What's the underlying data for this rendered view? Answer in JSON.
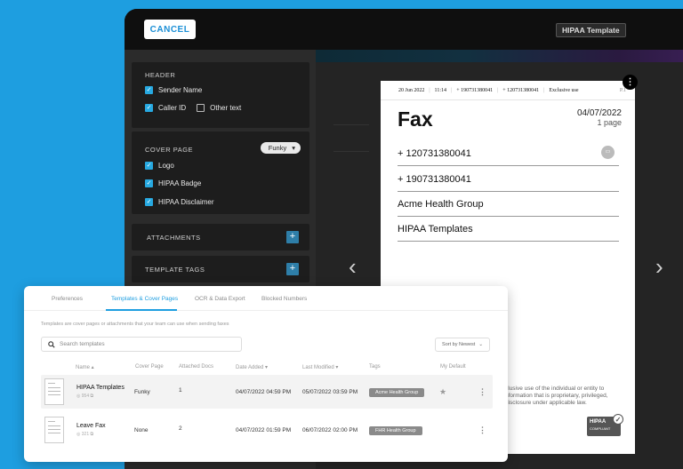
{
  "editor": {
    "cancel_label": "CANCEL",
    "title": "HIPAA Template",
    "sections": {
      "header": {
        "title": "HEADER",
        "sender_name": "Sender Name",
        "caller_id": "Caller ID",
        "other_text": "Other text"
      },
      "cover_page": {
        "title": "COVER PAGE",
        "dropdown_value": "Funky",
        "logo": "Logo",
        "hipaa_badge": "HIPAA Badge",
        "hipaa_disclaimer": "HIPAA Disclaimer"
      },
      "attachments": {
        "title": "ATTACHMENTS"
      },
      "template_tags": {
        "title": "TEMPLATE TAGS"
      }
    }
  },
  "fax": {
    "header": {
      "date": "20 Jun 2022",
      "time": "11:14",
      "from": "+ 190731380041",
      "to": "+ 120731380041",
      "label": "Exclusive use",
      "page": "P.1"
    },
    "title": "Fax",
    "date": "04/07/2022",
    "pages": "1 page",
    "fields": [
      "+ 120731380041",
      "+ 190731380041",
      "Acme Health Group",
      "HIPAA Templates"
    ],
    "disclaimer": "clusive use of the individual or entity to nformation that is proprietary, privileged, disclosure under applicable law.",
    "badge": {
      "title": "HIPAA",
      "subtitle": "COMPLIANT"
    }
  },
  "settings": {
    "tabs": [
      "Preferences",
      "Templates & Cover Pages",
      "OCR & Data Export",
      "Blocked Numbers"
    ],
    "description": "Templates are cover pages or attachments that your team can use when sending faxes",
    "search_placeholder": "Search templates",
    "sort_label": "Sort by Newest",
    "columns": [
      "Name ▴",
      "Cover Page",
      "Attached Docs",
      "Date Added ▾",
      "Last Modified ▾",
      "Tags",
      "My Default"
    ],
    "rows": [
      {
        "name": "HIPAA Templates",
        "meta": "954",
        "cover": "Funky",
        "docs": "1",
        "added": "04/07/2022 04:59 PM",
        "modified": "05/07/2022 03:59 PM",
        "tag": "Acme Health Group"
      },
      {
        "name": "Leave Fax",
        "meta": "321",
        "cover": "None",
        "docs": "2",
        "added": "04/07/2022 01:59 PM",
        "modified": "06/07/2022 02:00 PM",
        "tag": "FHR Health Group"
      }
    ]
  }
}
